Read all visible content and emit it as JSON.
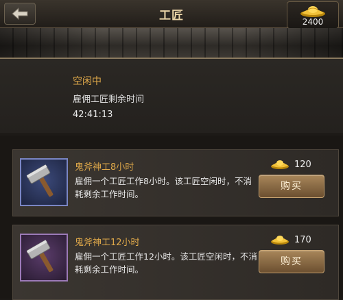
{
  "header": {
    "title": "工匠",
    "gold_amount": "2400"
  },
  "status": {
    "title": "空闲中",
    "subtitle": "雇佣工匠剩余时间",
    "time_left": "42:41:13"
  },
  "items": [
    {
      "name": "鬼斧神工8小时",
      "desc": "雇佣一个工匠工作8小时。该工匠空闲时，不消耗剩余工作时间。",
      "price": "120",
      "buy_label": "购买"
    },
    {
      "name": "鬼斧神工12小时",
      "desc": "雇佣一个工匠工作12小时。该工匠空闲时，不消耗剩余工作时间。",
      "price": "170",
      "buy_label": "购买"
    }
  ],
  "icons": {
    "back": "back-arrow-icon",
    "currency": "gold-ingot-icon",
    "item": "hammer-icon"
  },
  "colors": {
    "accent": "#e0a94a",
    "button": "#8a6a44",
    "item_border_1": "#7a86c4",
    "item_border_2": "#9c7ab8"
  }
}
